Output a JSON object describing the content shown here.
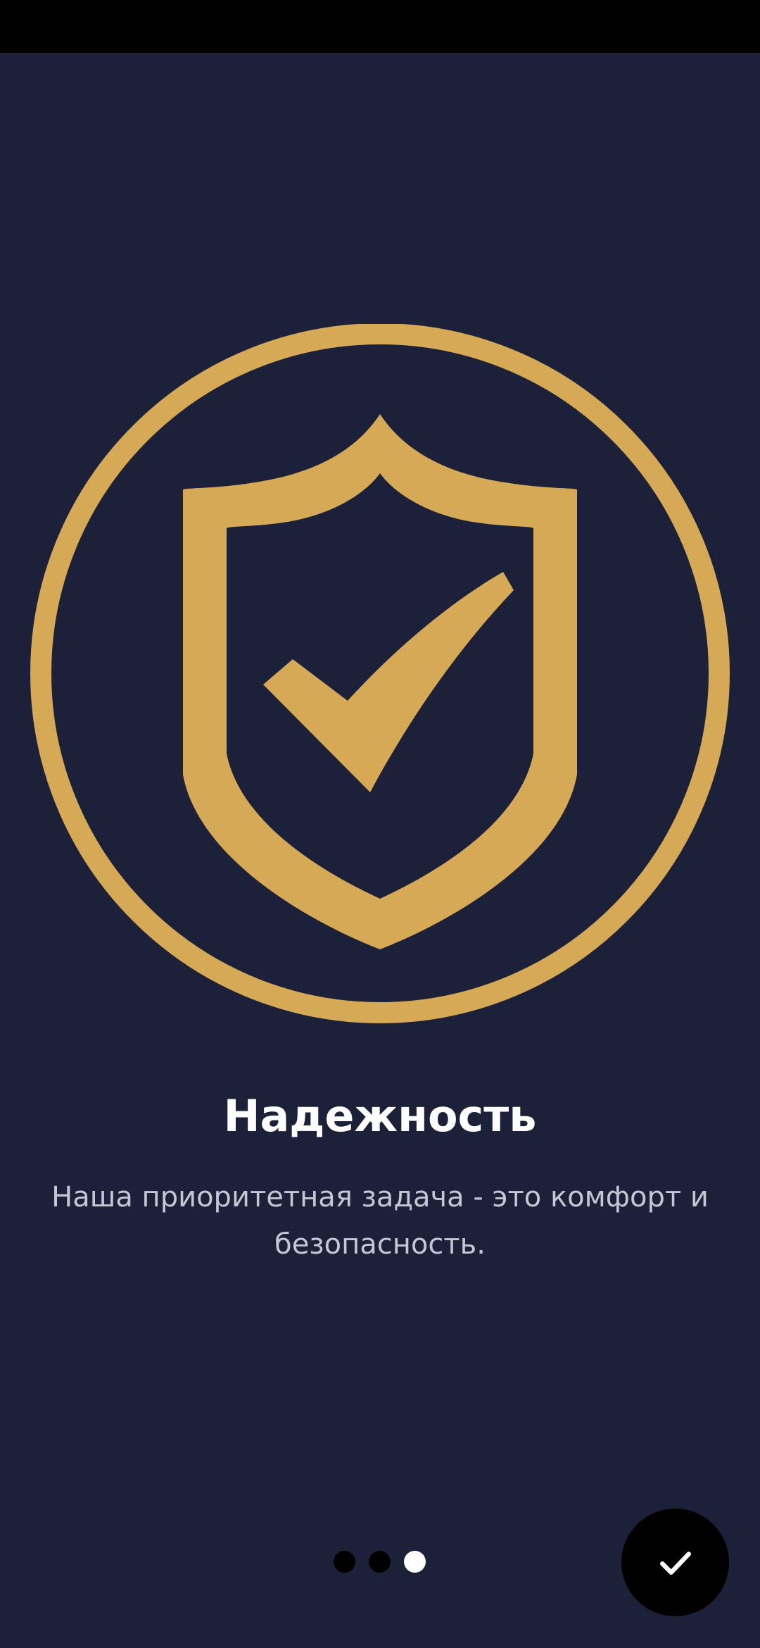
{
  "onboarding": {
    "title": "Надежность",
    "description": "Наша приоритетная задача - это комфорт и безопасность.",
    "pager": {
      "total": 3,
      "current": 3
    },
    "done_icon": "checkmark-icon",
    "emblem_icon": "shield-check-icon"
  },
  "colors": {
    "background": "#1c2039",
    "accent": "#d6a956",
    "title": "#ffffff",
    "description": "#c4c7d4",
    "fab": "#000000"
  }
}
